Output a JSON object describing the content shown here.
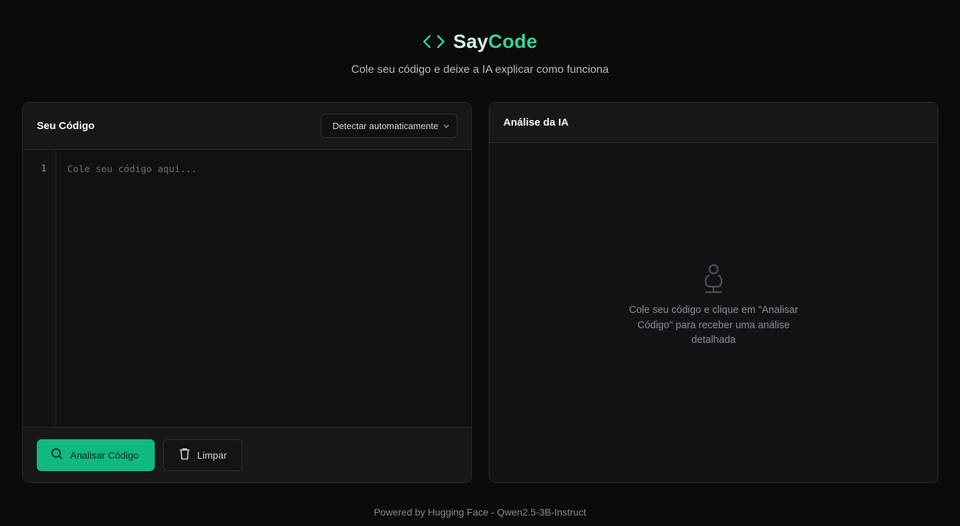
{
  "app": {
    "title_part1": "Say",
    "title_part2": "Code",
    "subtitle": "Cole seu código e deixe a IA explicar como funciona"
  },
  "colors": {
    "accent": "#34d399",
    "primary_button": "#10b981",
    "background": "#0b0b0c"
  },
  "editor_panel": {
    "title": "Seu Código",
    "language_select": {
      "selected": "Detectar automaticamente"
    },
    "line_numbers": [
      "1"
    ],
    "placeholder": "Cole seu código aqui...",
    "actions": {
      "analyze_label": "Analisar Código",
      "analyze_icon": "search-icon",
      "clear_label": "Limpar",
      "clear_icon": "trash-icon"
    }
  },
  "analysis_panel": {
    "title": "Análise da IA",
    "empty_icon": "robot-icon",
    "empty_message": "Cole seu código e clique em \"Analisar Código\" para receber uma análise detalhada"
  },
  "footer": {
    "text": "Powered by Hugging Face - Qwen2.5-3B-Instruct"
  }
}
